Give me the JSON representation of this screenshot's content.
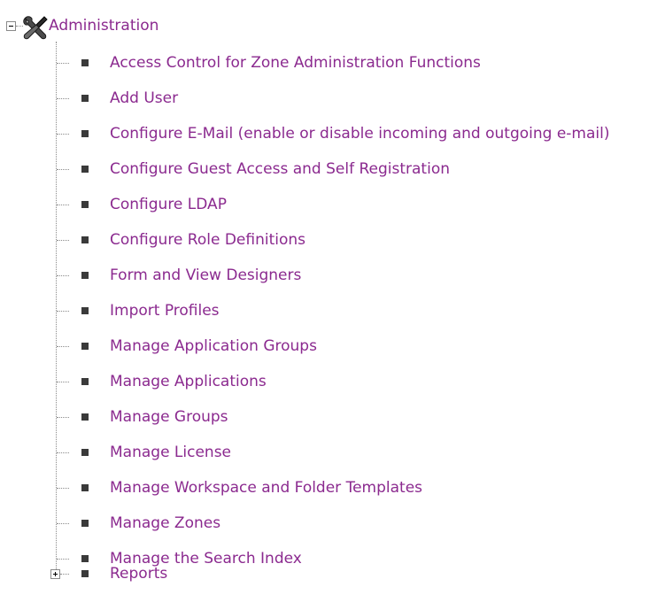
{
  "tree": {
    "root": {
      "label": "Administration",
      "expander": "minus",
      "icon": "tools-icon"
    },
    "items": [
      {
        "label": "Access Control for Zone Administration Functions"
      },
      {
        "label": "Add User"
      },
      {
        "label": "Configure E-Mail (enable or disable incoming and outgoing e-mail)"
      },
      {
        "label": "Configure Guest Access and Self Registration"
      },
      {
        "label": "Configure LDAP"
      },
      {
        "label": "Configure Role Definitions"
      },
      {
        "label": "Form and View Designers"
      },
      {
        "label": "Import Profiles"
      },
      {
        "label": "Manage Application Groups"
      },
      {
        "label": "Manage Applications"
      },
      {
        "label": "Manage Groups"
      },
      {
        "label": "Manage License"
      },
      {
        "label": "Manage Workspace and Folder Templates"
      },
      {
        "label": "Manage Zones"
      },
      {
        "label": "Manage the Search Index"
      },
      {
        "label": "Reports",
        "expander": "plus"
      }
    ],
    "colors": {
      "link": "#8b2a8f",
      "bullet": "#3a3a3a",
      "tree_line": "#8a8a8a"
    }
  }
}
